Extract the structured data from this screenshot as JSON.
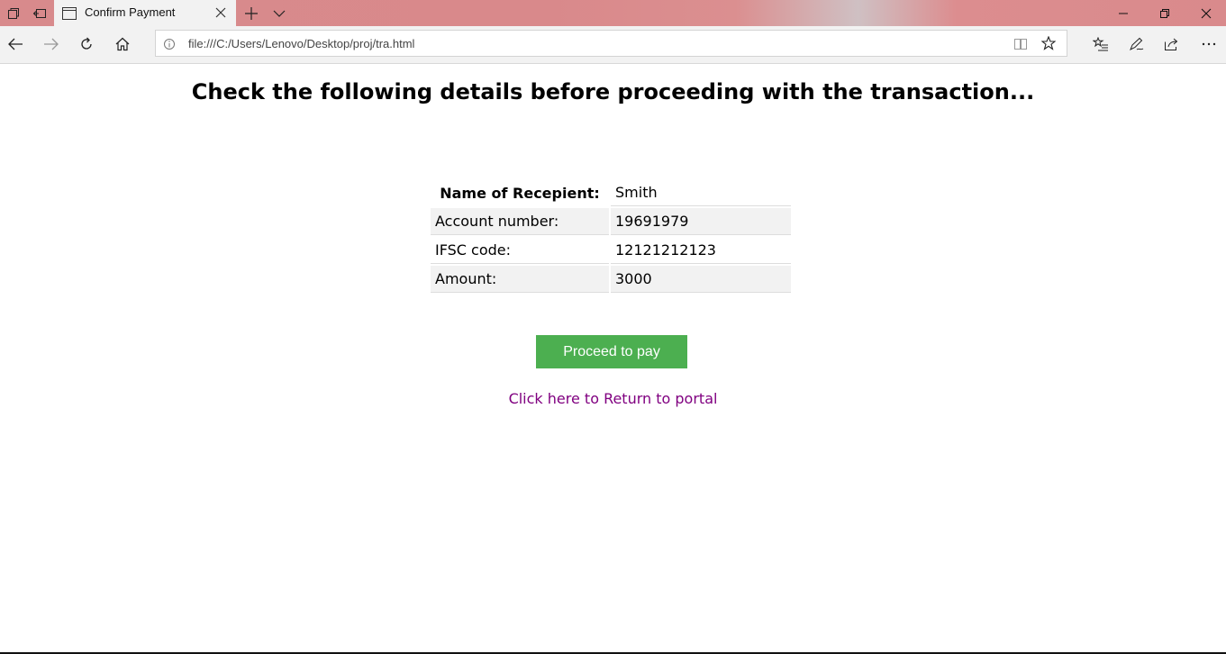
{
  "browser": {
    "tab_title": "Confirm Payment",
    "url": "file:///C:/Users/Lenovo/Desktop/proj/tra.html",
    "icons": {
      "tab_actions": "tab-list-icon",
      "set_aside": "set-aside-tabs-icon",
      "new_tab": "plus-icon",
      "tab_preview": "chevron-down-icon",
      "back": "back-arrow-icon",
      "forward": "forward-arrow-icon",
      "refresh": "refresh-icon",
      "home": "home-icon",
      "info": "info-icon",
      "reading_view": "reading-view-icon",
      "favorite": "star-icon",
      "hub": "favorites-hub-icon",
      "web_note": "pen-icon",
      "share": "share-icon",
      "more": "more-icon"
    }
  },
  "page": {
    "heading": "Check the following details before proceeding with the transaction...",
    "table": {
      "header_label": "Name of Recepient:",
      "header_value": "Smith",
      "rows": [
        {
          "label": "Account number:",
          "value": "19691979"
        },
        {
          "label": "IFSC code:",
          "value": "12121212123"
        },
        {
          "label": "Amount:",
          "value": "3000"
        }
      ]
    },
    "pay_button": "Proceed to pay",
    "return_link": "Click here to Return to portal"
  },
  "colors": {
    "button": "#4caf50",
    "link": "#800080",
    "row_shade": "#f2f2f2"
  }
}
